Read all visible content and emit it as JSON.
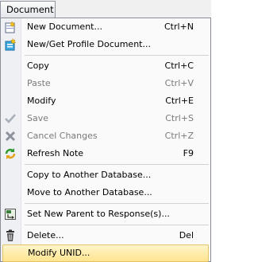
{
  "menubar": {
    "title": "Document"
  },
  "menu": {
    "items": [
      {
        "label": "New Document...",
        "shortcut": "Ctrl+N",
        "icon": "new-document-icon",
        "enabled": true
      },
      {
        "label": "New/Get Profile Document...",
        "shortcut": "",
        "icon": "profile-document-icon",
        "enabled": true
      },
      {
        "label": "Copy",
        "shortcut": "Ctrl+C",
        "icon": "",
        "enabled": true
      },
      {
        "label": "Paste",
        "shortcut": "Ctrl+V",
        "icon": "",
        "enabled": false
      },
      {
        "label": "Modify",
        "shortcut": "Ctrl+E",
        "icon": "",
        "enabled": true
      },
      {
        "label": "Save",
        "shortcut": "Ctrl+S",
        "icon": "checkmark-icon",
        "enabled": false
      },
      {
        "label": "Cancel Changes",
        "shortcut": "Ctrl+Z",
        "icon": "x-icon",
        "enabled": false
      },
      {
        "label": "Refresh Note",
        "shortcut": "F9",
        "icon": "refresh-icon",
        "enabled": true
      },
      {
        "label": "Copy to Another Database...",
        "shortcut": "",
        "icon": "",
        "enabled": true
      },
      {
        "label": "Move to Another Database...",
        "shortcut": "",
        "icon": "",
        "enabled": true
      },
      {
        "label": "Set New Parent to Response(s)...",
        "shortcut": "",
        "icon": "set-parent-icon",
        "enabled": true
      },
      {
        "label": "Delete...",
        "shortcut": "Del",
        "icon": "trash-icon",
        "enabled": true
      },
      {
        "label": "Modify UNID...",
        "shortcut": "",
        "icon": "",
        "enabled": true,
        "highlighted": true
      }
    ]
  },
  "colors": {
    "highlight_top": "#fff5cc",
    "highlight_bottom": "#ffe58f",
    "disabled_text": "#7a7a7a"
  }
}
